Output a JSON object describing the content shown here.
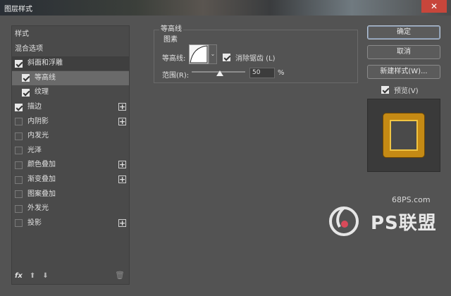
{
  "window": {
    "title": "图层样式",
    "close_label": "✕"
  },
  "stylelist": {
    "items": [
      {
        "label": "样式",
        "checkbox": false,
        "checked": false,
        "plus": false,
        "selected": false,
        "indent": false
      },
      {
        "label": "混合选项",
        "checkbox": false,
        "checked": false,
        "plus": false,
        "selected": false,
        "indent": false
      },
      {
        "label": "斜面和浮雕",
        "checkbox": true,
        "checked": true,
        "plus": false,
        "selected": false,
        "indent": false,
        "section": true
      },
      {
        "label": "等高线",
        "checkbox": true,
        "checked": true,
        "plus": false,
        "selected": true,
        "indent": true
      },
      {
        "label": "纹理",
        "checkbox": true,
        "checked": true,
        "plus": false,
        "selected": false,
        "indent": true
      },
      {
        "label": "描边",
        "checkbox": true,
        "checked": true,
        "plus": true,
        "selected": false,
        "indent": false
      },
      {
        "label": "内阴影",
        "checkbox": true,
        "checked": false,
        "plus": true,
        "selected": false,
        "indent": false
      },
      {
        "label": "内发光",
        "checkbox": true,
        "checked": false,
        "plus": false,
        "selected": false,
        "indent": false
      },
      {
        "label": "光泽",
        "checkbox": true,
        "checked": false,
        "plus": false,
        "selected": false,
        "indent": false
      },
      {
        "label": "颜色叠加",
        "checkbox": true,
        "checked": false,
        "plus": true,
        "selected": false,
        "indent": false
      },
      {
        "label": "渐变叠加",
        "checkbox": true,
        "checked": false,
        "plus": true,
        "selected": false,
        "indent": false
      },
      {
        "label": "图案叠加",
        "checkbox": true,
        "checked": false,
        "plus": false,
        "selected": false,
        "indent": false
      },
      {
        "label": "外发光",
        "checkbox": true,
        "checked": false,
        "plus": false,
        "selected": false,
        "indent": false
      },
      {
        "label": "投影",
        "checkbox": true,
        "checked": false,
        "plus": true,
        "selected": false,
        "indent": false
      }
    ],
    "plus_label": "+",
    "fx_label": "fx",
    "up_arrow": "⬆",
    "down_arrow": "⬇",
    "trash_icon": "🗑"
  },
  "contour_panel": {
    "group_title": "等高线",
    "sub_title": "图素",
    "contour_label": "等高线:",
    "antialias_label": "消除锯齿 (L)",
    "antialias_checked": true,
    "range_label": "范围(R):",
    "range_value": "50",
    "range_unit": "%",
    "dropdown_arrow": "⌄"
  },
  "buttons": {
    "ok": "确定",
    "cancel": "取消",
    "new_style": "新建样式(W)...",
    "preview_label": "预览(V)",
    "preview_checked": true
  },
  "watermark": {
    "url": "68PS.com",
    "brand": "PS联盟"
  },
  "colors": {
    "panel_bg": "#535353",
    "list_bg": "#4a4a4a",
    "selected_row": "#6a6a6a",
    "close_red": "#c7463b",
    "gold_frame": "#c58a14"
  }
}
